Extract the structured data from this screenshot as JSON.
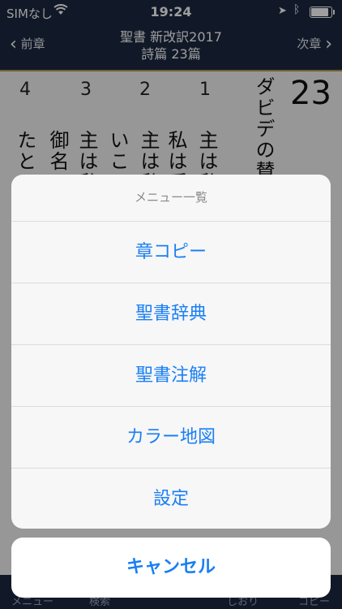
{
  "status": {
    "carrier": "SIMなし",
    "time": "19:24"
  },
  "nav": {
    "prev": "前章",
    "next": "次章",
    "title_line1": "聖書 新改訳2017",
    "title_line2": "詩篇 23篇"
  },
  "page": {
    "chapter": "23",
    "verse_numbers": [
      "4",
      "3",
      "2",
      "1"
    ],
    "columns": [
      "ダビデの賛歌",
      "主は私",
      "私は乏",
      "主は私",
      "いこ",
      "主は私",
      "御名の",
      "たと"
    ]
  },
  "tabs": [
    "メニュー",
    "検索",
    "",
    "しおり",
    "コピー"
  ],
  "sheet": {
    "title": "メニュー一覧",
    "items": [
      "章コピー",
      "聖書辞典",
      "聖書注解",
      "カラー地図",
      "設定"
    ],
    "cancel": "キャンセル"
  },
  "colors": {
    "navy": "#1c2942",
    "accent": "#1a7ff4",
    "gold": "#b59a4e"
  }
}
